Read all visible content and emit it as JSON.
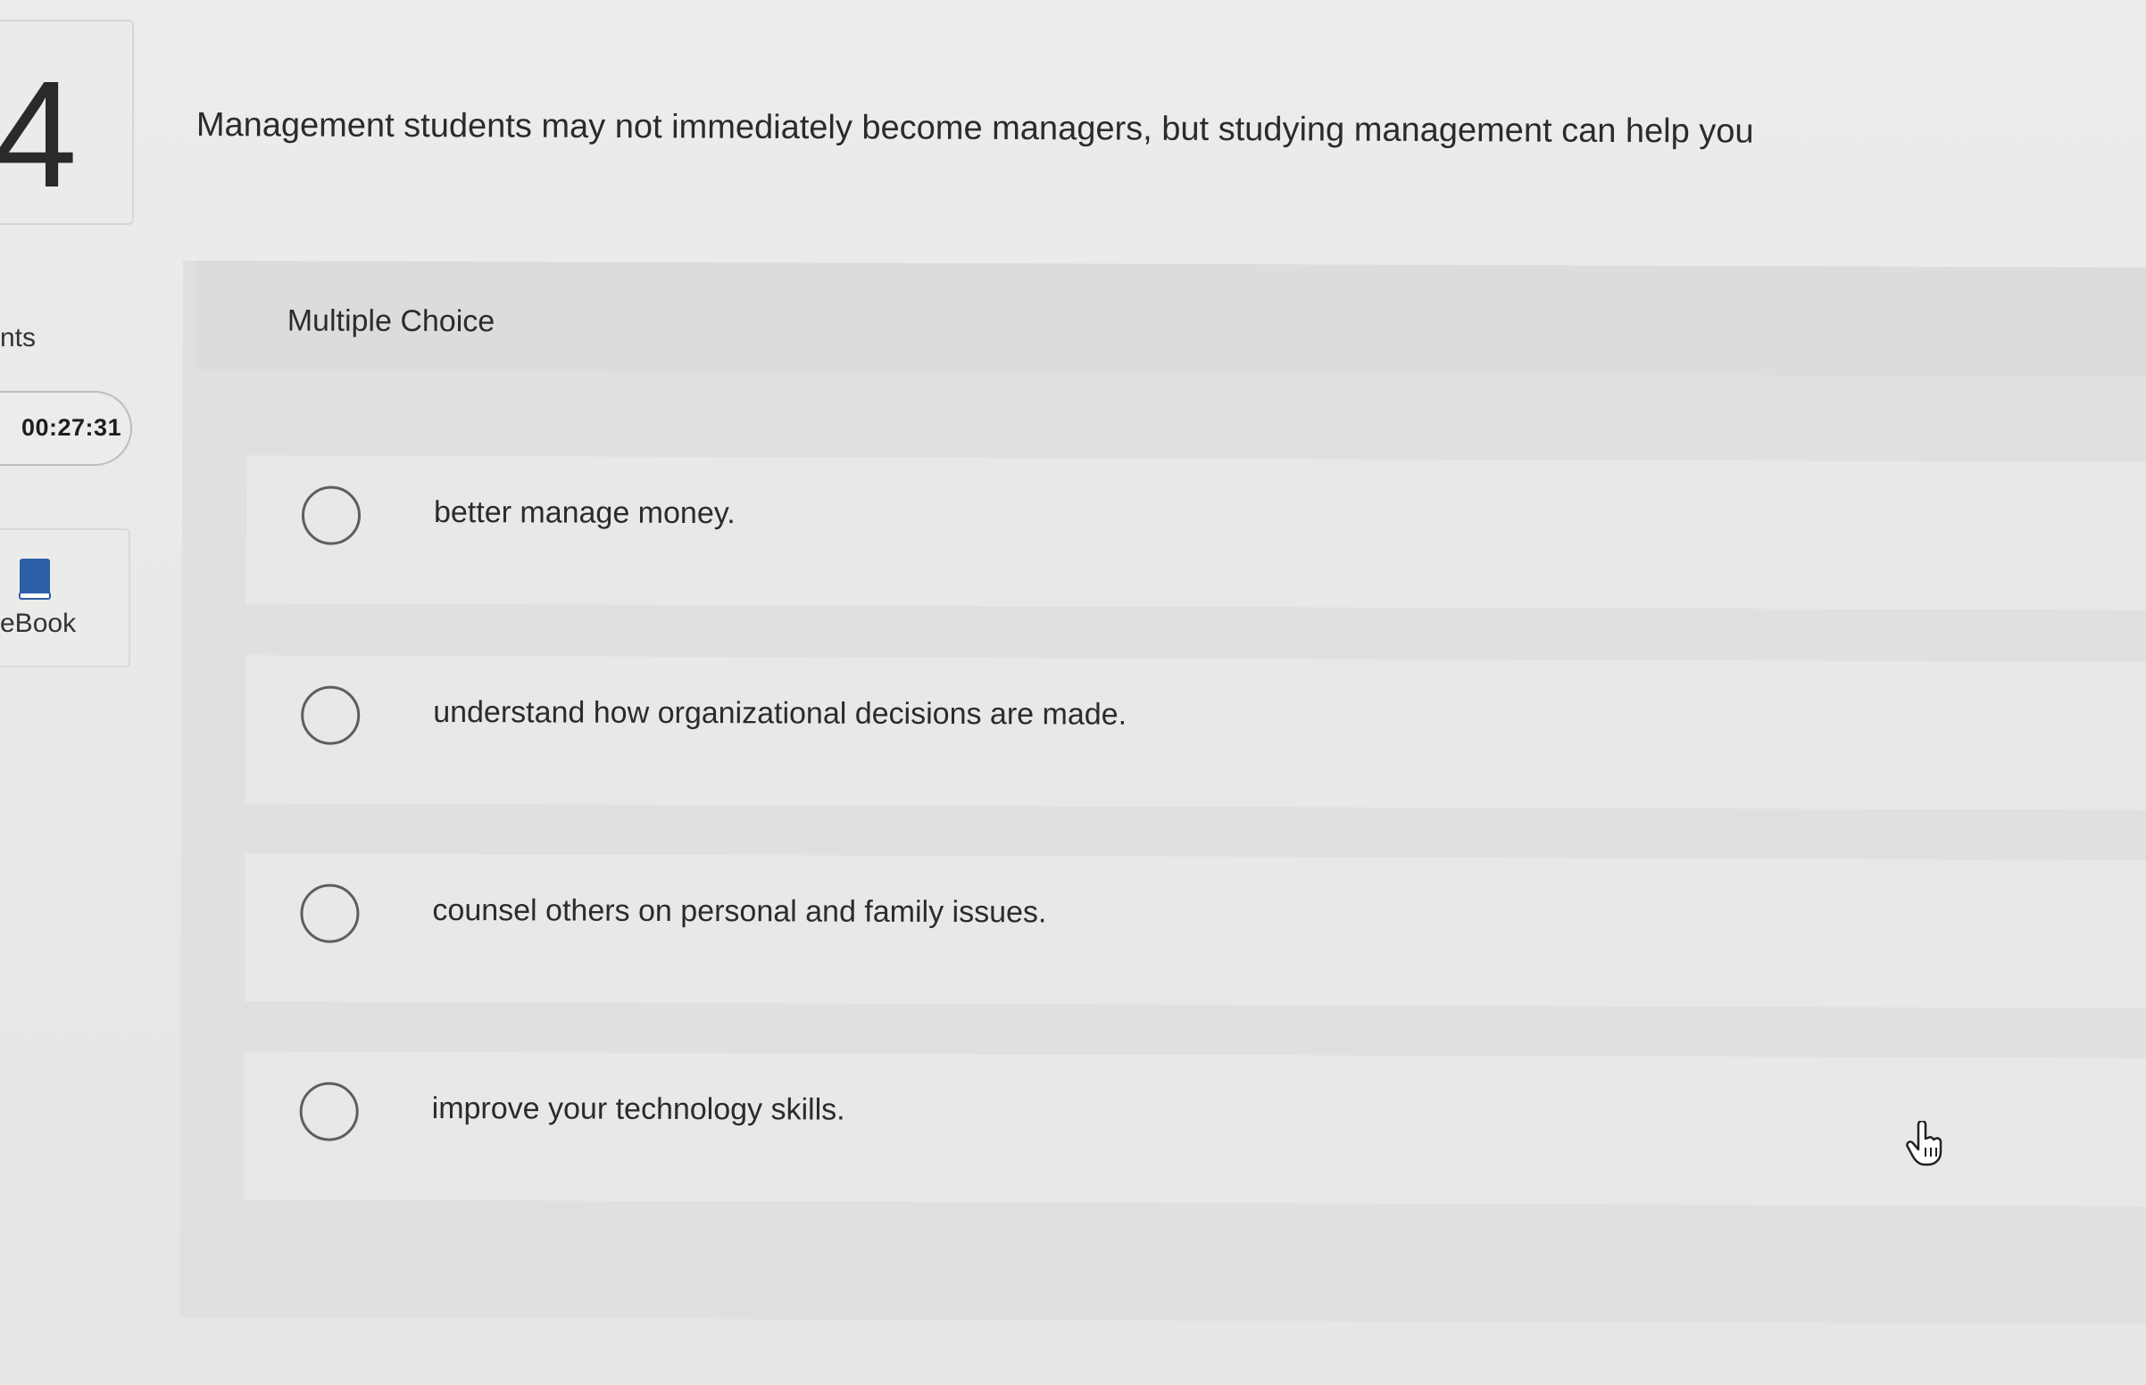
{
  "question": {
    "number": "4",
    "text": "Management students may not immediately become managers, but studying management can help you"
  },
  "sidebar": {
    "points_fragment": "nts",
    "timer": "00:27:31",
    "ebook_label": "eBook"
  },
  "panel": {
    "type_label": "Multiple Choice",
    "options": [
      {
        "label": "better manage money."
      },
      {
        "label": "understand how organizational decisions are made."
      },
      {
        "label": "counsel others on personal and family issues."
      },
      {
        "label": "improve your technology skills."
      }
    ]
  },
  "icons": {
    "ebook": "book-icon",
    "cursor": "hand-pointer-icon"
  },
  "colors": {
    "ebook_icon": "#2d5fa8",
    "radio_border": "#5e5e5e"
  }
}
